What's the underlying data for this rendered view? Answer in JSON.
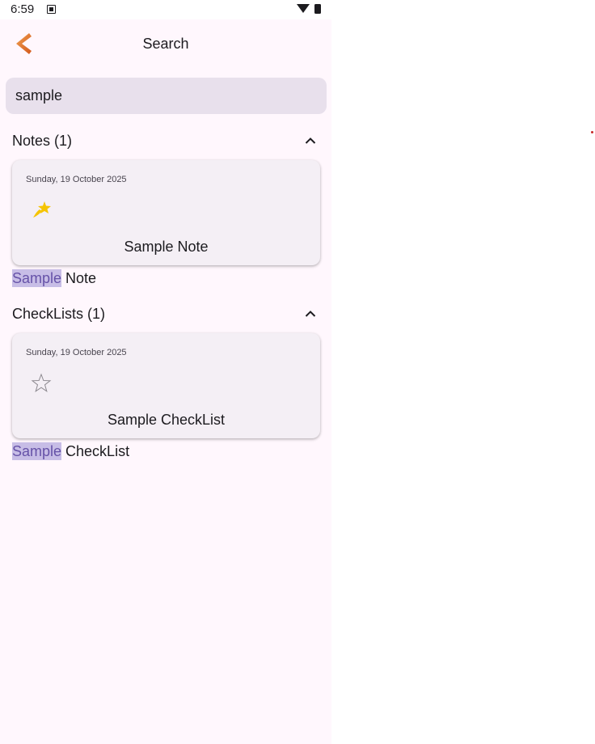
{
  "status_bar": {
    "time": "6:59"
  },
  "app_bar": {
    "title": "Search"
  },
  "search": {
    "value": "sample"
  },
  "sections": [
    {
      "title": "Notes (1)",
      "card": {
        "date": "Sunday, 19 October 2025",
        "title": "Sample Note",
        "favorite": true
      },
      "match": {
        "highlight": "Sample",
        "rest": " Note"
      }
    },
    {
      "title": "CheckLists (1)",
      "card": {
        "date": "Sunday, 19 October 2025",
        "title": "Sample CheckList",
        "favorite": false
      },
      "match": {
        "highlight": "Sample",
        "rest": " CheckList"
      }
    }
  ],
  "colors": {
    "accent": "#e07a2b",
    "star_filled": "#f5c400",
    "highlight_bg": "#c7bde6",
    "highlight_text": "#6652a8"
  }
}
